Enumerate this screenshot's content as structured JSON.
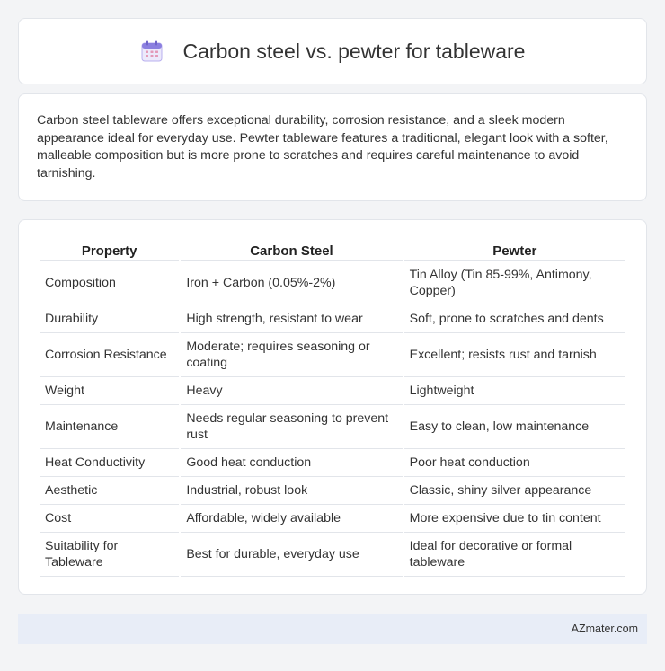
{
  "header": {
    "title": "Carbon steel vs. pewter for tableware",
    "icon": "calendar-icon",
    "icon_color": "#8b7fe0"
  },
  "intro": {
    "text": "Carbon steel tableware offers exceptional durability, corrosion resistance, and a sleek modern appearance ideal for everyday use. Pewter tableware features a traditional, elegant look with a softer, malleable composition but is more prone to scratches and requires careful maintenance to avoid tarnishing."
  },
  "table": {
    "headers": [
      "Property",
      "Carbon Steel",
      "Pewter"
    ],
    "rows": [
      [
        "Composition",
        "Iron + Carbon (0.05%-2%)",
        "Tin Alloy (Tin 85-99%, Antimony, Copper)"
      ],
      [
        "Durability",
        "High strength, resistant to wear",
        "Soft, prone to scratches and dents"
      ],
      [
        "Corrosion Resistance",
        "Moderate; requires seasoning or coating",
        "Excellent; resists rust and tarnish"
      ],
      [
        "Weight",
        "Heavy",
        "Lightweight"
      ],
      [
        "Maintenance",
        "Needs regular seasoning to prevent rust",
        "Easy to clean, low maintenance"
      ],
      [
        "Heat Conductivity",
        "Good heat conduction",
        "Poor heat conduction"
      ],
      [
        "Aesthetic",
        "Industrial, robust look",
        "Classic, shiny silver appearance"
      ],
      [
        "Cost",
        "Affordable, widely available",
        "More expensive due to tin content"
      ],
      [
        "Suitability for Tableware",
        "Best for durable, everyday use",
        "Ideal for decorative or formal tableware"
      ]
    ]
  },
  "footer": {
    "brand": "AZmater.com"
  }
}
